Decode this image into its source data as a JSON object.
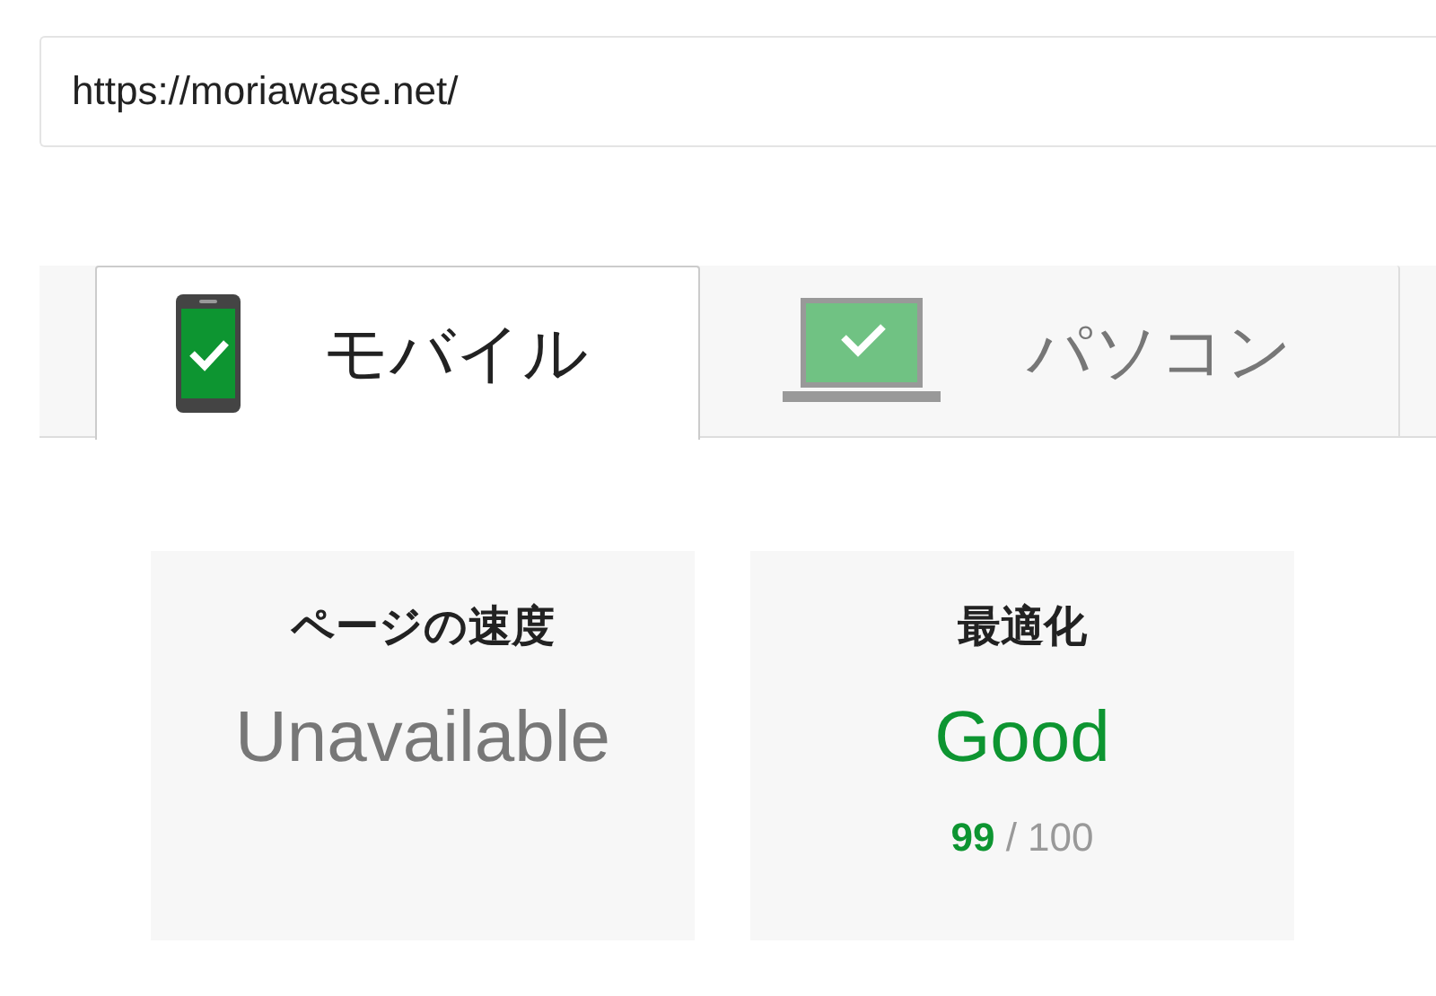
{
  "url_field": {
    "value": "https://moriawase.net/"
  },
  "tabs": [
    {
      "label": "モバイル",
      "kind": "phone",
      "selected": true
    },
    {
      "label": "パソコン",
      "kind": "laptop",
      "selected": false
    }
  ],
  "cards": [
    {
      "title": "ページの速度",
      "kind": "unavailable",
      "status": "Unavailable"
    },
    {
      "title": "最適化",
      "kind": "good",
      "status": "Good",
      "score": "99",
      "score_rest": "/ 100"
    }
  ]
}
